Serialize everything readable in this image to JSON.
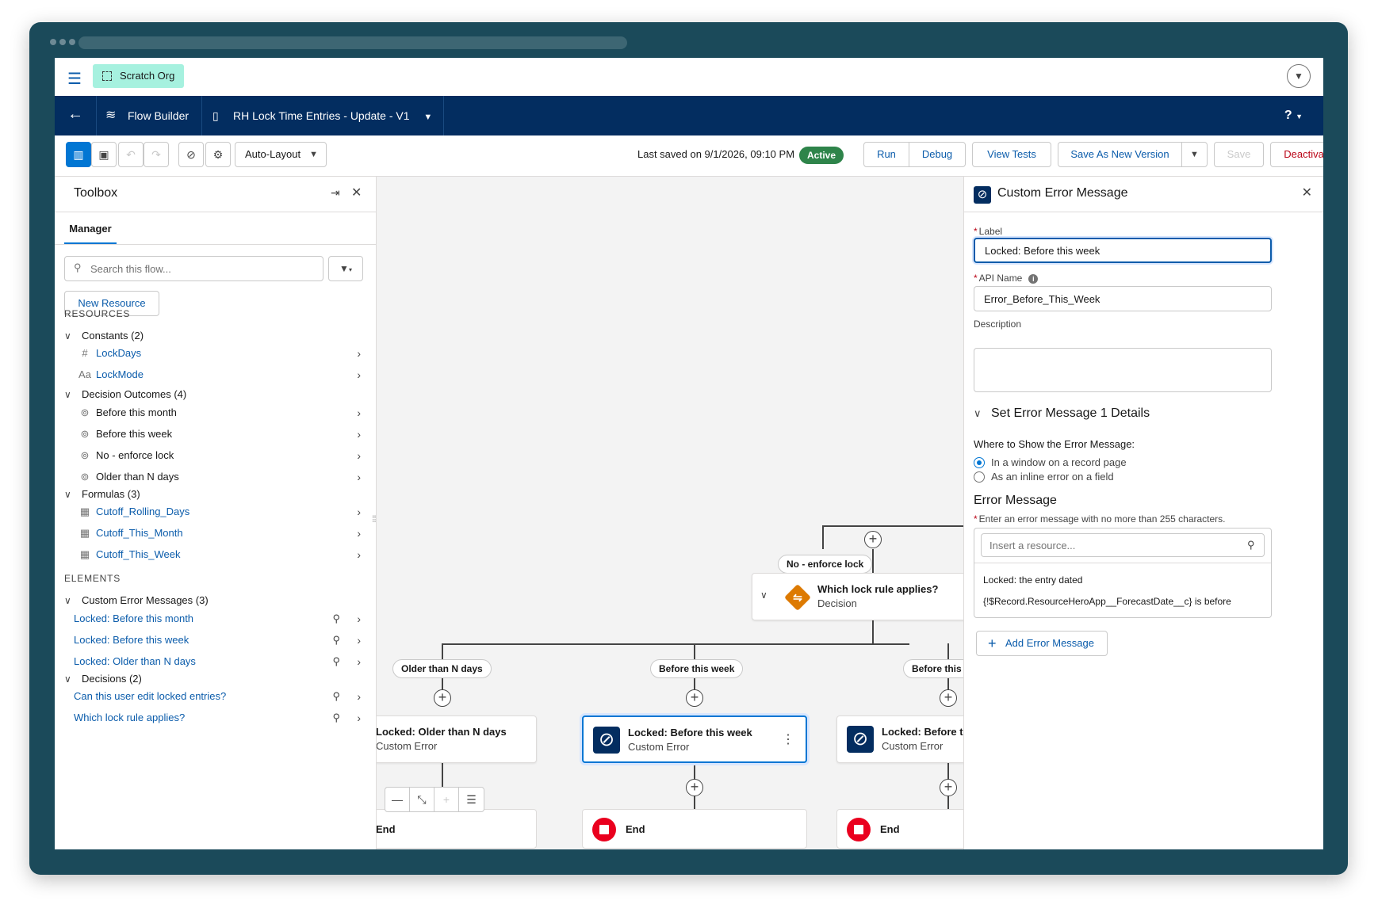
{
  "topbar": {
    "org_name": "Scratch Org"
  },
  "navbar": {
    "app_name": "Flow Builder",
    "flow_name": "RH Lock Time Entries - Update - V1",
    "help": "?"
  },
  "toolbar": {
    "layout_mode": "Auto-Layout",
    "last_saved": "Last saved on 9/1/2026, 09:10 PM",
    "status": "Active",
    "run": "Run",
    "debug": "Debug",
    "view_tests": "View Tests",
    "save_as_new": "Save As New Version",
    "save": "Save",
    "deactivate": "Deactivate"
  },
  "toolbox": {
    "title": "Toolbox",
    "tab": "Manager",
    "search_placeholder": "Search this flow...",
    "new_resource": "New Resource",
    "resources_heading": "RESOURCES",
    "elements_heading": "ELEMENTS",
    "constants": {
      "label": "Constants (2)",
      "items": [
        "LockDays",
        "LockMode"
      ]
    },
    "outcomes": {
      "label": "Decision Outcomes (4)",
      "items": [
        "Before this month",
        "Before this week",
        "No - enforce lock",
        "Older than N days"
      ]
    },
    "formulas": {
      "label": "Formulas (3)",
      "items": [
        "Cutoff_Rolling_Days",
        "Cutoff_This_Month",
        "Cutoff_This_Week"
      ]
    },
    "custom_errors": {
      "label": "Custom Error Messages (3)",
      "items": [
        "Locked: Before this month",
        "Locked: Before this week",
        "Locked: Older than N days"
      ]
    },
    "decisions": {
      "label": "Decisions (2)",
      "items": [
        "Can this user edit locked entries?",
        "Which lock rule applies?"
      ]
    }
  },
  "canvas": {
    "outcome_top": "No - enforce lock",
    "decision": {
      "title": "Which lock rule applies?",
      "type": "Decision"
    },
    "outcomes": [
      "Older than N days",
      "Before this week",
      "Before this month"
    ],
    "nodes": [
      {
        "title": "Locked: Older than N days",
        "type": "Custom Error"
      },
      {
        "title": "Locked: Before this week",
        "type": "Custom Error"
      },
      {
        "title": "Locked: Before this month",
        "type": "Custom Error"
      }
    ],
    "end_label": "End"
  },
  "panel": {
    "title": "Custom Error Message",
    "label_label": "Label",
    "label_value": "Locked: Before this week",
    "api_label": "API Name",
    "api_value": "Error_Before_This_Week",
    "desc_label": "Description",
    "section": "Set Error Message 1 Details",
    "where": "Where to Show the Error Message:",
    "option1": "In a window on a record page",
    "option2": "As an inline error on a field",
    "err_title": "Error Message",
    "err_hint": "Enter an error message with no more than 255 characters.",
    "resource_placeholder": "Insert a resource...",
    "err_line1": "Locked: the entry dated",
    "err_line2": "{!$Record.ResourceHeroApp__ForecastDate__c} is before",
    "add": "Add Error Message"
  }
}
